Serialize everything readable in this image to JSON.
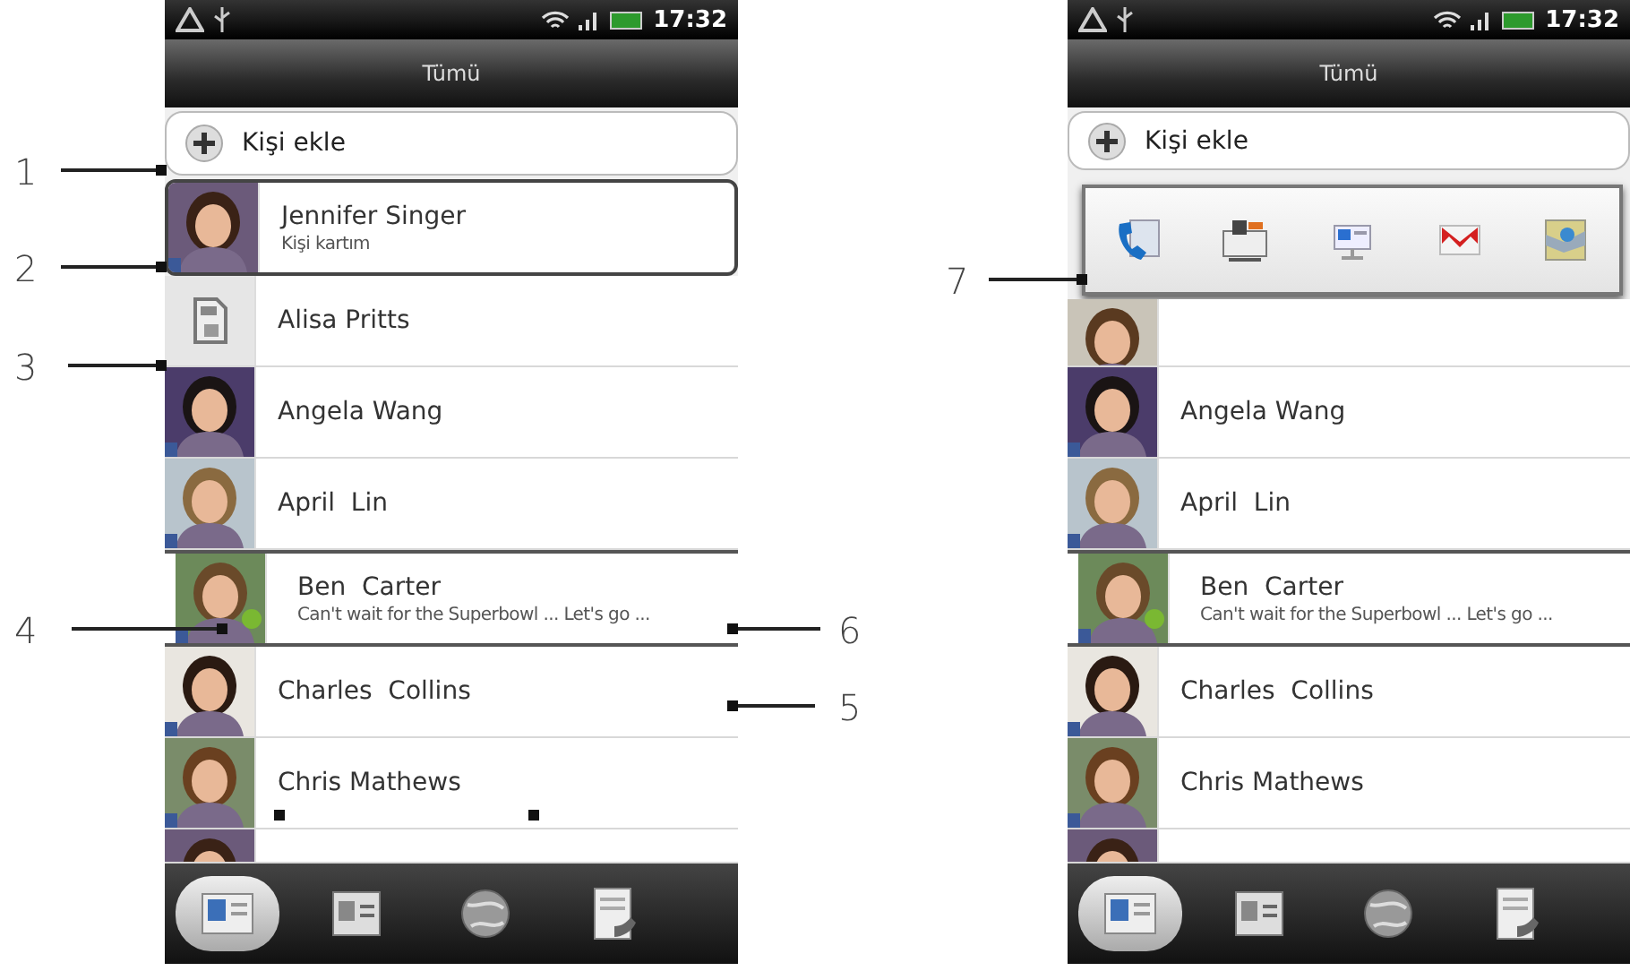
{
  "callouts": [
    {
      "label": "1"
    },
    {
      "label": "2"
    },
    {
      "label": "3"
    },
    {
      "label": "4"
    },
    {
      "label": "6"
    },
    {
      "label": "5"
    },
    {
      "label": "7"
    }
  ],
  "phones": [
    {
      "time": "17:32",
      "title": "Tümü",
      "add_contact": "Kişi ekle",
      "quick_contact_bar": false,
      "contacts": [
        {
          "kind": "card",
          "name": "Jennifer Singer",
          "detail": "Kişi kartım"
        },
        {
          "kind": "sim",
          "name": "Alisa Pritts"
        },
        {
          "kind": "row",
          "name": "Angela Wang"
        },
        {
          "kind": "row",
          "name": "April  Lin"
        },
        {
          "kind": "status",
          "name": "Ben  Carter",
          "detail": "Can't wait for the Superbowl ... Let's go ...",
          "online": true
        },
        {
          "kind": "row",
          "name": "Charles  Collins"
        },
        {
          "kind": "row",
          "name": "Chris Mathews"
        },
        {
          "kind": "cut"
        }
      ],
      "tabs": [
        {
          "selected": true
        },
        {
          "selected": false
        },
        {
          "selected": false
        },
        {
          "selected": false
        }
      ]
    },
    {
      "time": "17:32",
      "title": "Tümü",
      "add_contact": "Kişi ekle",
      "quick_contact_bar": true,
      "contacts": [
        {
          "kind": "hidden"
        },
        {
          "kind": "row",
          "name": "Angela Wang"
        },
        {
          "kind": "row",
          "name": "April  Lin"
        },
        {
          "kind": "status",
          "name": "Ben  Carter",
          "detail": "Can't wait for the Superbowl ... Let's go ...",
          "online": true
        },
        {
          "kind": "row",
          "name": "Charles  Collins"
        },
        {
          "kind": "row",
          "name": "Chris Mathews"
        },
        {
          "kind": "cut"
        }
      ],
      "tabs": [
        {
          "selected": true
        },
        {
          "selected": false
        },
        {
          "selected": false
        },
        {
          "selected": false
        }
      ]
    }
  ]
}
